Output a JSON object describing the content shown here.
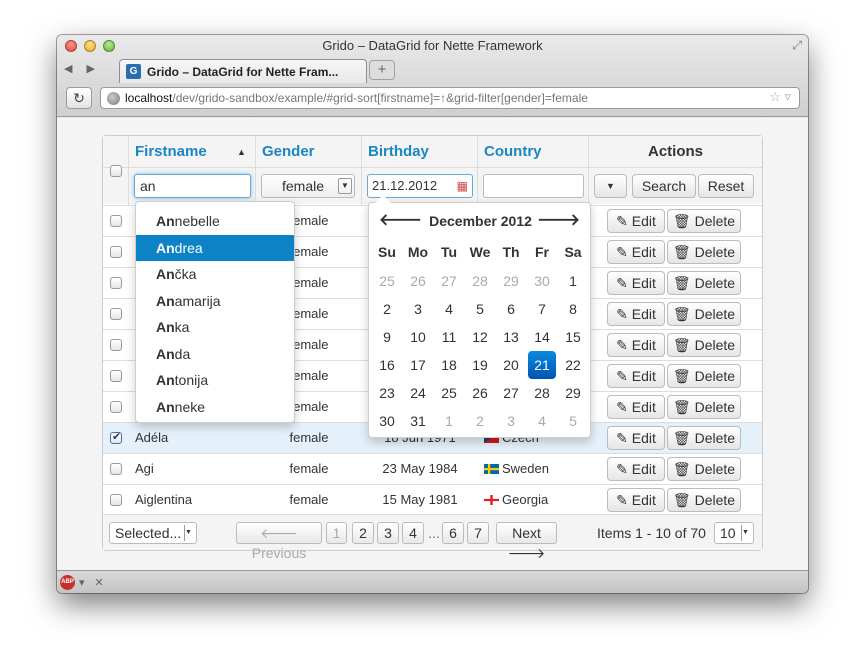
{
  "window": {
    "title": "Grido – DataGrid for Nette Framework",
    "tab_label": "Grido – DataGrid for Nette Fram...",
    "url_host": "localhost",
    "url_path": "/dev/grido-sandbox/example/#grid-sort[firstname]=↑&grid-filter[gender]=female"
  },
  "grid": {
    "columns": {
      "firstname": "Firstname",
      "gender": "Gender",
      "birthday": "Birthday",
      "country": "Country",
      "actions": "Actions"
    },
    "sort_arrow": "▲",
    "filters": {
      "firstname_value": "an",
      "gender_value": "female",
      "birthday_value": "21.12.2012",
      "country_value": ""
    },
    "buttons": {
      "search": "Search",
      "reset": "Reset",
      "edit": "Edit",
      "delete": "Delete"
    },
    "rows": [
      {
        "firstname": "",
        "gender": "female",
        "birthday": "",
        "country": "",
        "checked": false
      },
      {
        "firstname": "",
        "gender": "female",
        "birthday": "",
        "country": "",
        "checked": false
      },
      {
        "firstname": "",
        "gender": "female",
        "birthday": "",
        "country": "",
        "checked": false
      },
      {
        "firstname": "",
        "gender": "female",
        "birthday": "",
        "country": "",
        "checked": false
      },
      {
        "firstname": "",
        "gender": "female",
        "birthday": "",
        "country": "",
        "checked": false
      },
      {
        "firstname": "",
        "gender": "female",
        "birthday": "",
        "country": "",
        "checked": false
      },
      {
        "firstname": "",
        "gender": "female",
        "birthday": "",
        "country": "",
        "checked": false
      },
      {
        "firstname": "Adéla",
        "gender": "female",
        "birthday": "18 Jun 1971",
        "country": "Czech",
        "checked": true
      },
      {
        "firstname": "Agi",
        "gender": "female",
        "birthday": "23 May 1984",
        "country": "Sweden",
        "checked": false
      },
      {
        "firstname": "Aiglentina",
        "gender": "female",
        "birthday": "15 May 1981",
        "country": "Georgia",
        "checked": false
      }
    ],
    "footer": {
      "selected": "Selected...",
      "previous": "Previous",
      "next": "Next",
      "pages": [
        "1",
        "2",
        "3",
        "4",
        "...",
        "6",
        "7"
      ],
      "items_info": "Items 1 - 10 of 70",
      "per_page": "10"
    }
  },
  "autocomplete": {
    "query": "An",
    "items": [
      {
        "match": "An",
        "rest": "nebelle"
      },
      {
        "match": "An",
        "rest": "drea"
      },
      {
        "match": "An",
        "rest": "čka"
      },
      {
        "match": "An",
        "rest": "amarija"
      },
      {
        "match": "An",
        "rest": "ka"
      },
      {
        "match": "An",
        "rest": "da"
      },
      {
        "match": "An",
        "rest": "tonija"
      },
      {
        "match": "An",
        "rest": "neke"
      }
    ],
    "active_index": 1
  },
  "datepicker": {
    "month_label": "December 2012",
    "prev": "🡐",
    "next": "🡒",
    "weekdays": [
      "Su",
      "Mo",
      "Tu",
      "We",
      "Th",
      "Fr",
      "Sa"
    ],
    "days": [
      "25",
      "26",
      "27",
      "28",
      "29",
      "30",
      "1",
      "2",
      "3",
      "4",
      "5",
      "6",
      "7",
      "8",
      "9",
      "10",
      "11",
      "12",
      "13",
      "14",
      "15",
      "16",
      "17",
      "18",
      "19",
      "20",
      "21",
      "22",
      "23",
      "24",
      "25",
      "26",
      "27",
      "28",
      "29",
      "30",
      "31",
      "1",
      "2",
      "3",
      "4",
      "5"
    ],
    "other_month_indices": [
      0,
      1,
      2,
      3,
      4,
      5,
      37,
      38,
      39,
      40,
      41
    ],
    "selected_index": 26
  },
  "colors": {
    "accent": "#1a86c4",
    "highlight": "#0d83c6",
    "selected_row": "#e4f0fa"
  }
}
